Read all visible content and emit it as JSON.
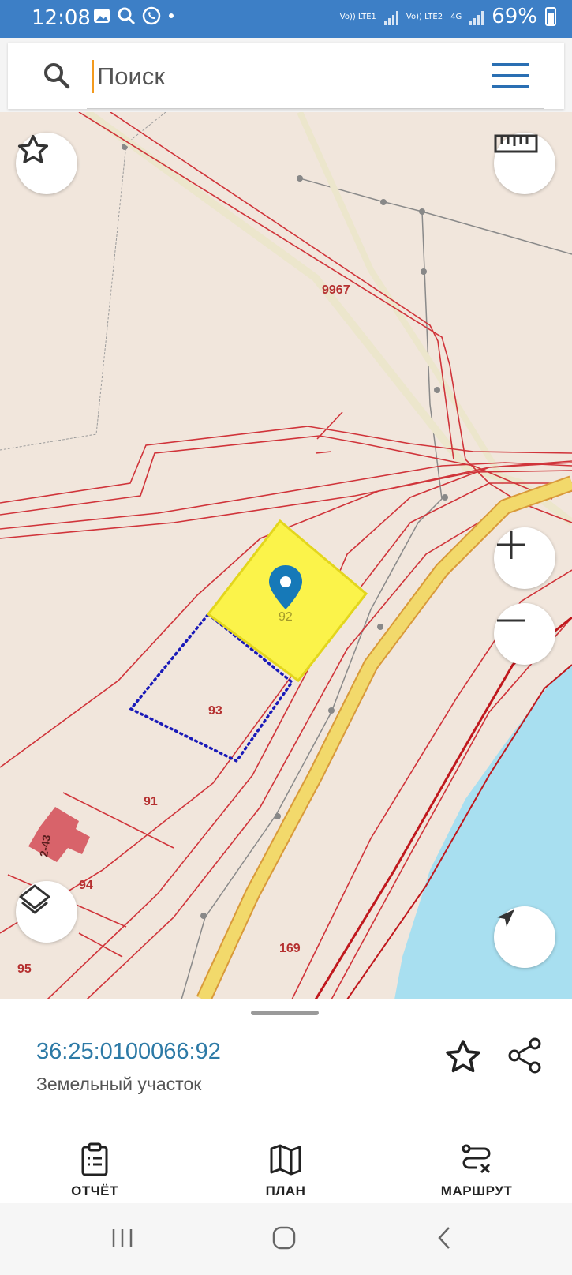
{
  "status_bar": {
    "time": "12:08",
    "sim1": "Vo)) LTE1",
    "sim2": "Vo)) LTE2",
    "network": "4G",
    "battery": "69%"
  },
  "search": {
    "placeholder": "Поиск",
    "icon": "search-icon",
    "menu_icon": "hamburger-menu-icon"
  },
  "map": {
    "labels": {
      "l9967": "9967",
      "l92": "92",
      "l93": "93",
      "l91": "91",
      "l94": "94",
      "l243": "2-43",
      "l95": "95",
      "l169": "169"
    },
    "colors": {
      "background": "#f1e6dc",
      "boundary": "#d0343a",
      "selected_parcel": "#fbf34a",
      "road": "#f2d96b",
      "water": "#a8dff0",
      "dotted_outline": "#1a1ab8"
    },
    "buttons": [
      "star-icon",
      "ruler-icon",
      "zoom-in-icon",
      "zoom-out-icon",
      "layers-icon",
      "navigation-arrow-icon"
    ]
  },
  "parcel": {
    "cadastral_number": "36:25:0100066:92",
    "type": "Земельный участок"
  },
  "tabs": [
    {
      "label": "ОТЧЁТ",
      "icon": "report-clipboard-icon"
    },
    {
      "label": "ПЛАН",
      "icon": "map-plan-icon"
    },
    {
      "label": "МАРШРУТ",
      "icon": "route-icon"
    }
  ]
}
